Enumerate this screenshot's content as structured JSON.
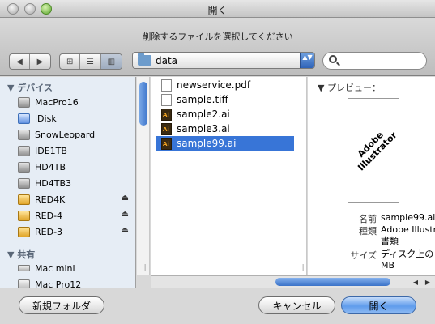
{
  "window": {
    "title": "開く"
  },
  "toolbar": {
    "prompt": "削除するファイルを選択してください",
    "nav_back": "◀",
    "nav_forward": "▶",
    "view_icons": "⊞",
    "view_list": "☰",
    "view_columns": "▥",
    "location": "data",
    "location_arrows": "▲▼",
    "search_value": ""
  },
  "sidebar": {
    "devices_header": "▼ デバイス",
    "devices": [
      {
        "label": "MacPro16",
        "icon": "internal-disk-icon"
      },
      {
        "label": "iDisk",
        "icon": "idisk-icon"
      },
      {
        "label": "SnowLeopard",
        "icon": "internal-disk-icon"
      },
      {
        "label": "IDE1TB",
        "icon": "internal-disk-icon"
      },
      {
        "label": "HD4TB",
        "icon": "internal-disk-icon"
      },
      {
        "label": "HD4TB3",
        "icon": "internal-disk-icon"
      },
      {
        "label": "RED4K",
        "icon": "external-disk-icon",
        "eject": "⏏"
      },
      {
        "label": "RED-4",
        "icon": "external-disk-icon",
        "eject": "⏏"
      },
      {
        "label": "RED-3",
        "icon": "external-disk-icon",
        "eject": "⏏"
      }
    ],
    "shared_header": "▼ 共有",
    "shared": [
      {
        "label": "Mac mini",
        "icon": "mac-mini-icon"
      },
      {
        "label": "Mac Pro12",
        "icon": "mac-pro-icon"
      }
    ]
  },
  "files": [
    {
      "name": "newservice.pdf",
      "icon": "pdf-file-icon",
      "selected": false
    },
    {
      "name": "sample.tiff",
      "icon": "tiff-file-icon",
      "selected": false
    },
    {
      "name": "sample2.ai",
      "icon": "ai-file-icon",
      "selected": false
    },
    {
      "name": "sample3.ai",
      "icon": "ai-file-icon",
      "selected": false
    },
    {
      "name": "sample99.ai",
      "icon": "ai-file-icon",
      "selected": true
    }
  ],
  "preview": {
    "header": "▼ プレビュー：",
    "logo_line1": "Adobe",
    "logo_line2": "Illustrator",
    "name_label": "名前",
    "name_value": "sample99.ai",
    "kind_label": "種類",
    "kind_value_1": "Adobe Illustr",
    "kind_value_2": "書類",
    "size_label": "サイズ",
    "size_value_1": "ディスク上の",
    "size_value_2": "MB"
  },
  "buttons": {
    "new_folder": "新規フォルダ",
    "cancel": "キャンセル",
    "open": "開く"
  },
  "colors": {
    "selection": "#3875d7",
    "sidebar_bg": "#e6edf5",
    "sidebar_header": "#5a6778"
  }
}
